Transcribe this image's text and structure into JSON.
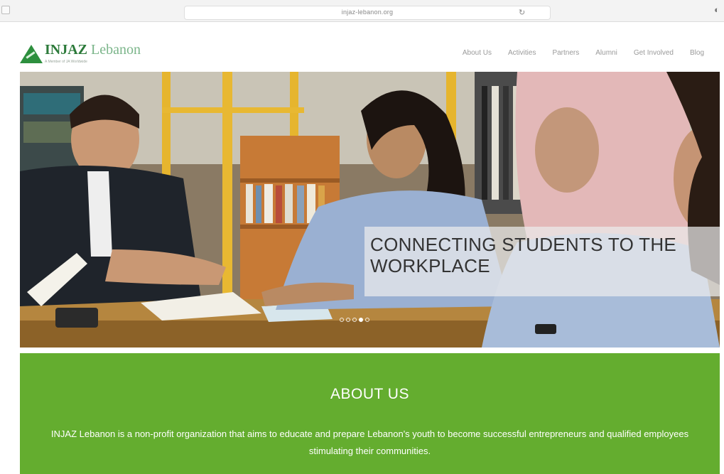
{
  "browser": {
    "url": "injaz-lebanon.org",
    "reload_icon": "reload-icon",
    "extension_icon": "extension-icon"
  },
  "header": {
    "logo": {
      "name_bold": "INJAZ",
      "name_light": "Lebanon",
      "tagline": "A Member of JA Worldwide",
      "accent_color": "#2d8f3e"
    },
    "nav": [
      {
        "label": "About Us"
      },
      {
        "label": "Activities"
      },
      {
        "label": "Partners"
      },
      {
        "label": "Alumni"
      },
      {
        "label": "Get Involved"
      },
      {
        "label": "Blog"
      }
    ]
  },
  "hero": {
    "caption": "CONNECTING STUDENTS TO THE WORKPLACE",
    "slides_count": 5,
    "active_slide": 4
  },
  "about": {
    "title": "ABOUT US",
    "text": "INJAZ Lebanon is a non-profit organization that aims to educate and prepare Lebanon's youth to become successful entrepreneurs and qualified employees stimulating their communities.",
    "background_color": "#64ad2f"
  }
}
